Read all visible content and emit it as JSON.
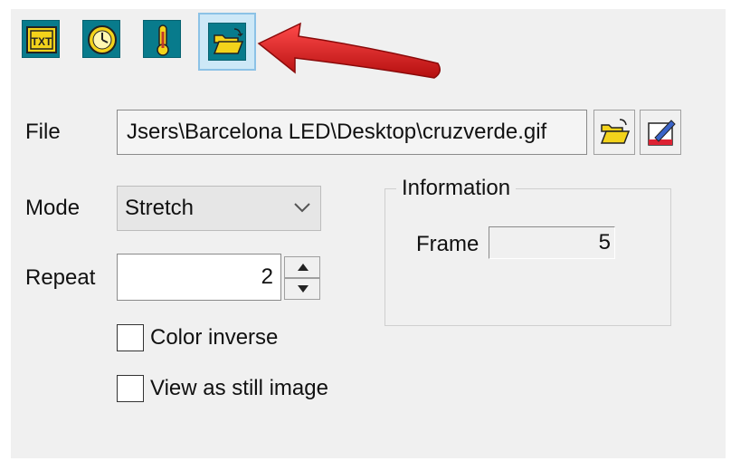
{
  "toolbar": {
    "buttons": [
      {
        "name": "text-mode-button",
        "icon": "txt-icon",
        "label": "TXT"
      },
      {
        "name": "clock-mode-button",
        "icon": "clock-icon"
      },
      {
        "name": "temperature-mode-button",
        "icon": "thermometer-icon"
      },
      {
        "name": "image-mode-button",
        "icon": "folder-open-icon",
        "active": true
      }
    ]
  },
  "annotation": {
    "icon": "red-arrow",
    "color": "#e01b1b"
  },
  "file": {
    "label": "File",
    "value": "Jsers\\Barcelona LED\\Desktop\\cruzverde.gif",
    "open_icon": "folder-open-icon",
    "edit_icon": "edit-image-icon"
  },
  "mode": {
    "label": "Mode",
    "selected": "Stretch"
  },
  "repeat": {
    "label": "Repeat",
    "value": "2"
  },
  "options": {
    "color_inverse": {
      "label": "Color inverse",
      "checked": false
    },
    "still_image": {
      "label": "View as still image",
      "checked": false
    }
  },
  "information": {
    "title": "Information",
    "frame_label": "Frame",
    "frame_value": "5"
  },
  "colors": {
    "toolbar_teal": "#087b8c",
    "icon_yellow": "#f3d31b",
    "arrow_red": "#e01b1b"
  }
}
